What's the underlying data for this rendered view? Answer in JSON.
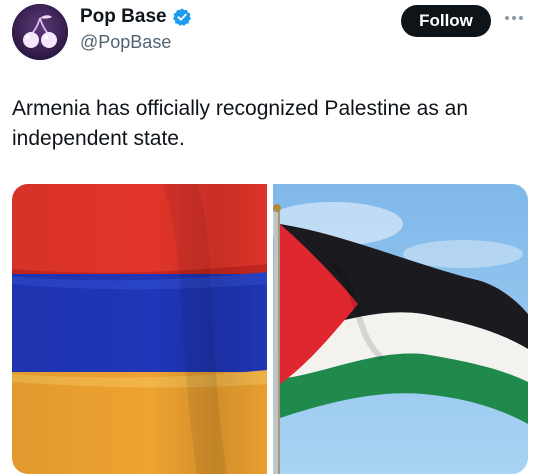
{
  "tweet": {
    "display_name": "Pop Base",
    "handle": "@PopBase",
    "follow_label": "Follow",
    "text": "Armenia has officially recognized Palestine as an independent state.",
    "avatar_icon": "cherry-avatar-icon",
    "verified_icon": "verified-badge-icon",
    "more_icon": "more-options-icon"
  },
  "media": {
    "images": [
      {
        "subject": "armenia-flag-image"
      },
      {
        "subject": "palestine-flag-image"
      }
    ]
  },
  "colors": {
    "verified": "#1d9bf0",
    "follow_bg": "#0f1419",
    "armenia_red": "#e2352a",
    "armenia_blue": "#1f36b8",
    "armenia_orange": "#eea231",
    "sky": "#8ec6ef"
  }
}
